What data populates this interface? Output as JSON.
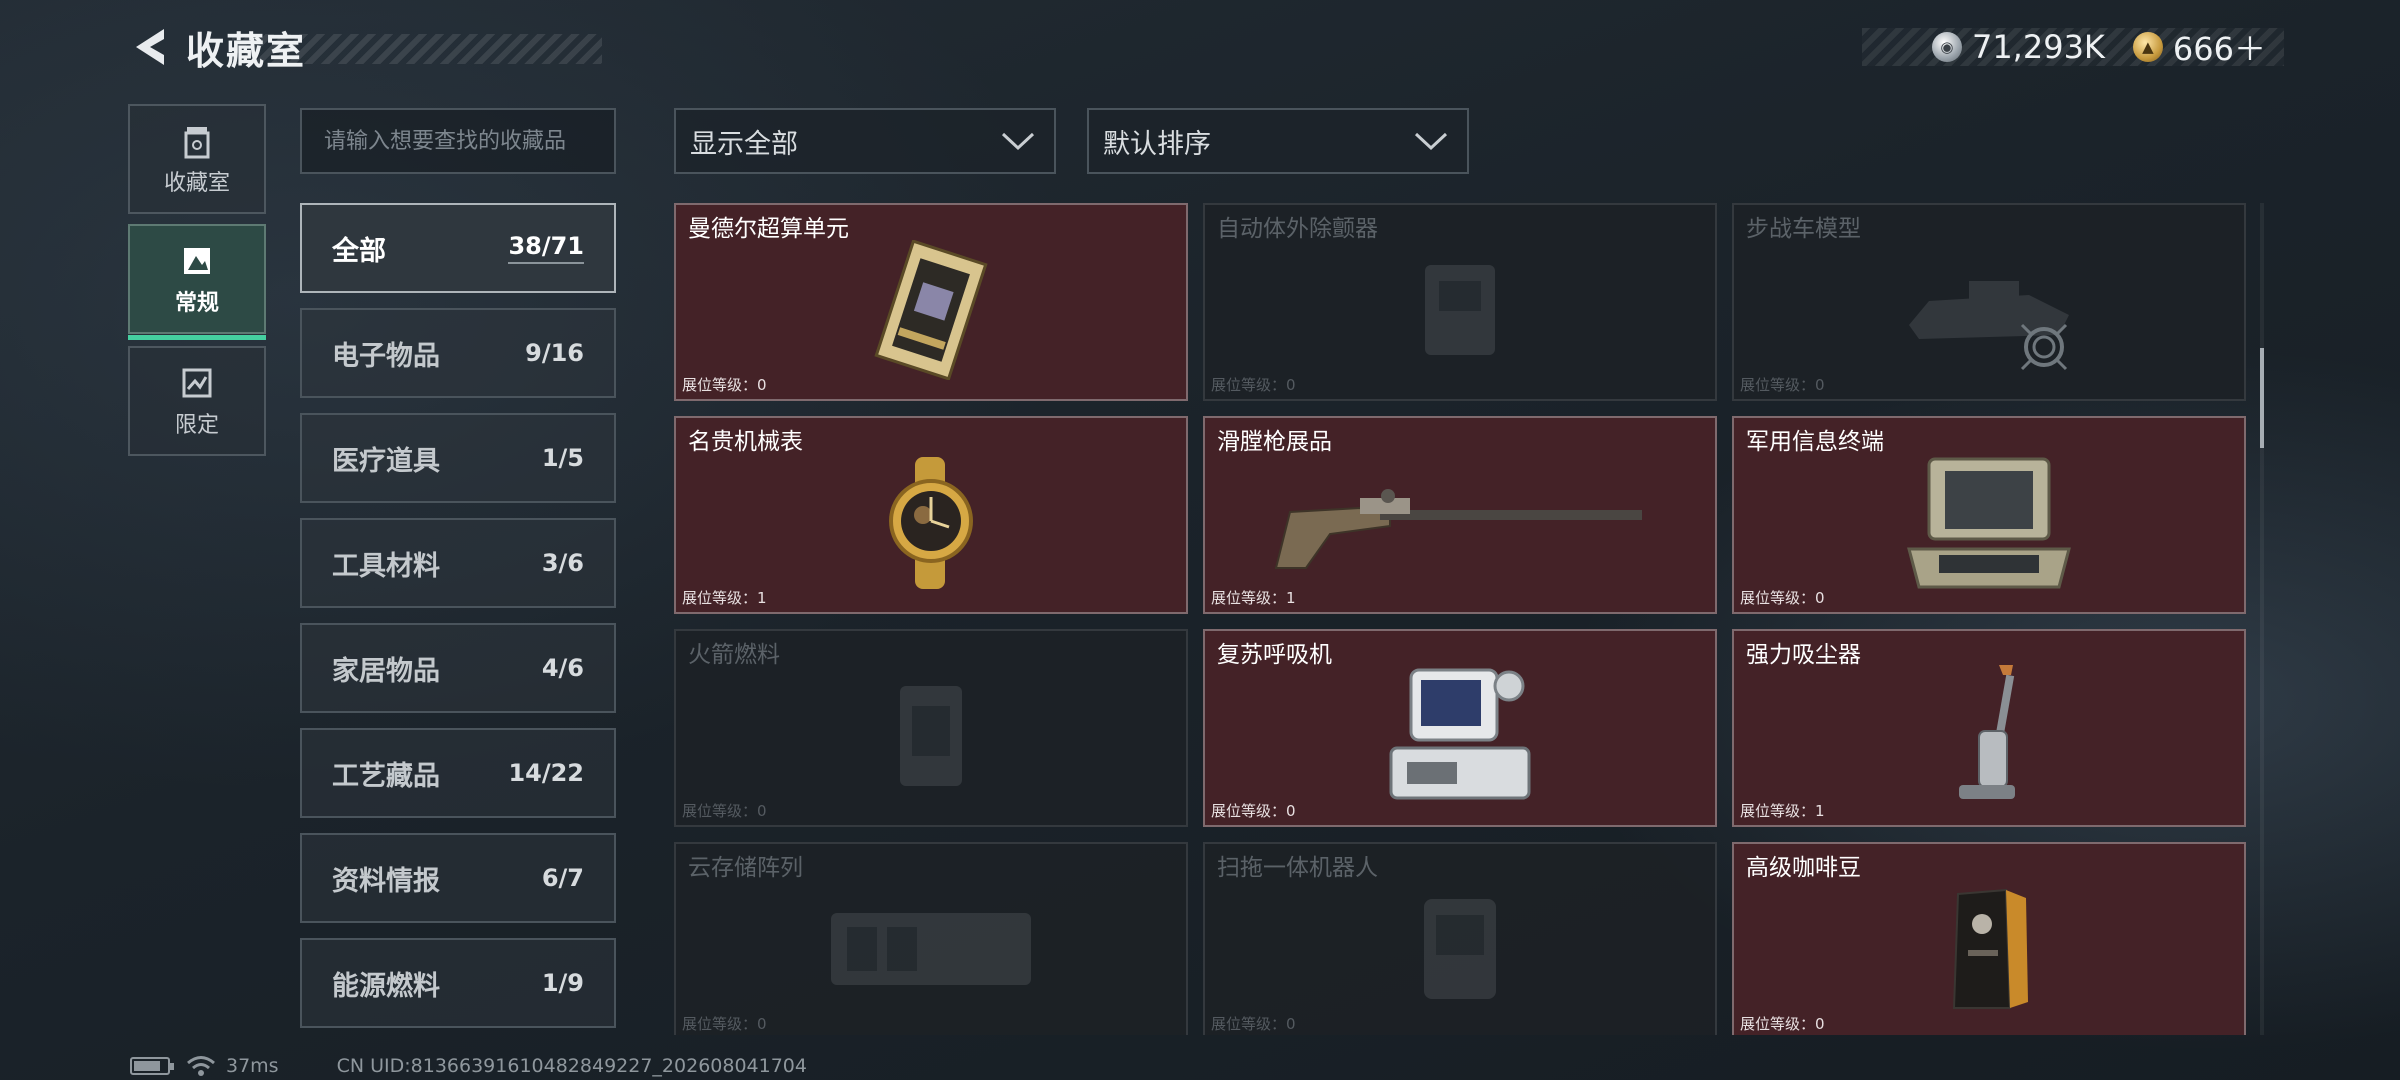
{
  "header": {
    "title": "收藏室"
  },
  "currency": [
    {
      "icon": "silver-coin-icon",
      "value": "71,293K"
    },
    {
      "icon": "gold-coin-icon",
      "value": "666＋"
    }
  ],
  "side_tabs": [
    {
      "label": "收藏室",
      "icon": "collection-room-icon",
      "active": false
    },
    {
      "label": "常规",
      "icon": "regular-items-icon",
      "active": true
    },
    {
      "label": "限定",
      "icon": "limited-items-icon",
      "active": false
    }
  ],
  "search": {
    "placeholder": "请输入想要查找的收藏品",
    "value": ""
  },
  "categories": [
    {
      "label": "全部",
      "count": "38/71",
      "active": true
    },
    {
      "label": "电子物品",
      "count": "9/16"
    },
    {
      "label": "医疗道具",
      "count": "1/5"
    },
    {
      "label": "工具材料",
      "count": "3/6"
    },
    {
      "label": "家居物品",
      "count": "4/6"
    },
    {
      "label": "工艺藏品",
      "count": "14/22"
    },
    {
      "label": "资料情报",
      "count": "6/7"
    },
    {
      "label": "能源燃料",
      "count": "1/9"
    }
  ],
  "filters": {
    "show": "显示全部",
    "sort": "默认排序"
  },
  "items": [
    {
      "name": "曼德尔超算单元",
      "level": "展位等级：0",
      "owned": true
    },
    {
      "name": "自动体外除颤器",
      "level": "展位等级：0",
      "owned": false
    },
    {
      "name": "步战车模型",
      "level": "展位等级：0",
      "owned": false
    },
    {
      "name": "名贵机械表",
      "level": "展位等级：1",
      "owned": true
    },
    {
      "name": "滑膛枪展品",
      "level": "展位等级：1",
      "owned": true
    },
    {
      "name": "军用信息终端",
      "level": "展位等级：0",
      "owned": true
    },
    {
      "name": "火箭燃料",
      "level": "展位等级：0",
      "owned": false
    },
    {
      "name": "复苏呼吸机",
      "level": "展位等级：0",
      "owned": true
    },
    {
      "name": "强力吸尘器",
      "level": "展位等级：1",
      "owned": true
    },
    {
      "name": "云存储阵列",
      "level": "展位等级：0",
      "owned": false
    },
    {
      "name": "扫拖一体机器人",
      "level": "展位等级：0",
      "owned": false
    },
    {
      "name": "高级咖啡豆",
      "level": "展位等级：0",
      "owned": true
    }
  ],
  "status": {
    "ping": "37ms",
    "uid": "CN UID:81366391610482849227_202608041704"
  },
  "colors": {
    "accent": "#45d0a0",
    "owned_card_bg": "#442227",
    "locked_card_bg": "#1c2126"
  }
}
